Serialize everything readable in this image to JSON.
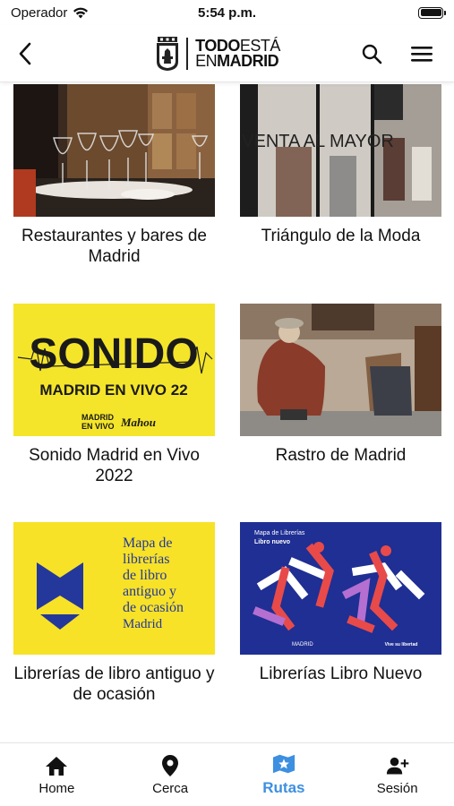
{
  "status_bar": {
    "carrier": "Operador",
    "time": "5:54 p.m."
  },
  "header": {
    "logo_line1_bold": "TODO",
    "logo_line1_rest": "ESTÁ",
    "logo_line2_light": "EN",
    "logo_line2_bold": "MADRID",
    "icons": [
      "back-arrow-icon",
      "search-icon",
      "menu-icon"
    ]
  },
  "cards": [
    {
      "title": "Restaurantes y bares de Madrid"
    },
    {
      "title": "Triángulo de la Moda",
      "image_text": "VENTA AL MAYOR"
    },
    {
      "title": "Sonido Madrid en Vivo 2022",
      "image_title": "SONIDO",
      "image_subtitle": "MADRID EN VIVO 22",
      "image_logo_left_1": "MADRID",
      "image_logo_left_2": "EN VIVO",
      "image_logo_right": "Mahou"
    },
    {
      "title": "Rastro de Madrid"
    },
    {
      "title": "Librerías de libro antiguo y de ocasión",
      "image_lines": [
        "Mapa de",
        "librerías",
        "de libro",
        "antiguo y",
        "de ocasión"
      ],
      "image_city": "Madrid"
    },
    {
      "title": "Librerías Libro Nuevo",
      "image_top": "Mapa de Librerías",
      "image_top_bold": "Libro nuevo",
      "image_bottom_left": "MADRID",
      "image_bottom_right": "Vive su libertad"
    }
  ],
  "bottom_nav": {
    "items": [
      {
        "label": "Home",
        "icon": "home-icon"
      },
      {
        "label": "Cerca",
        "icon": "location-pin-icon"
      },
      {
        "label": "Rutas",
        "icon": "map-star-icon",
        "active": true
      },
      {
        "label": "Sesión",
        "icon": "add-user-icon"
      }
    ]
  },
  "colors": {
    "active": "#3d8fe0",
    "sonido_yellow": "#f5e52a",
    "libro_yellow": "#f7e227",
    "libro_blue": "#24389b",
    "nuevo_blue": "#1f2f93"
  }
}
